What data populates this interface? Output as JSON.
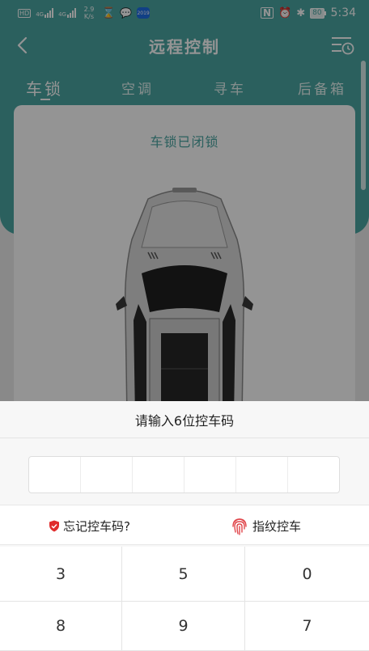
{
  "status_bar": {
    "network_badge": "HD",
    "signal_1": "4G",
    "signal_2": "4G",
    "speed_value": "2.9",
    "speed_unit": "K/s",
    "app_badge": "2019",
    "battery": "80",
    "time": "5:34"
  },
  "header": {
    "title": "远程控制"
  },
  "tabs": [
    "车锁",
    "空调",
    "寻车",
    "后备箱"
  ],
  "main": {
    "lock_status": "车锁已闭锁"
  },
  "dialog": {
    "title": "请输入6位控车码",
    "code_length": 6,
    "forgot_label": "忘记控车码?",
    "fingerprint_label": "指纹控车",
    "keys": [
      "3",
      "5",
      "0",
      "8",
      "9",
      "7"
    ]
  },
  "colors": {
    "brand_teal": "#4aa6a2",
    "shield_red": "#e02c2c",
    "fingerprint_red": "#e0454a"
  }
}
